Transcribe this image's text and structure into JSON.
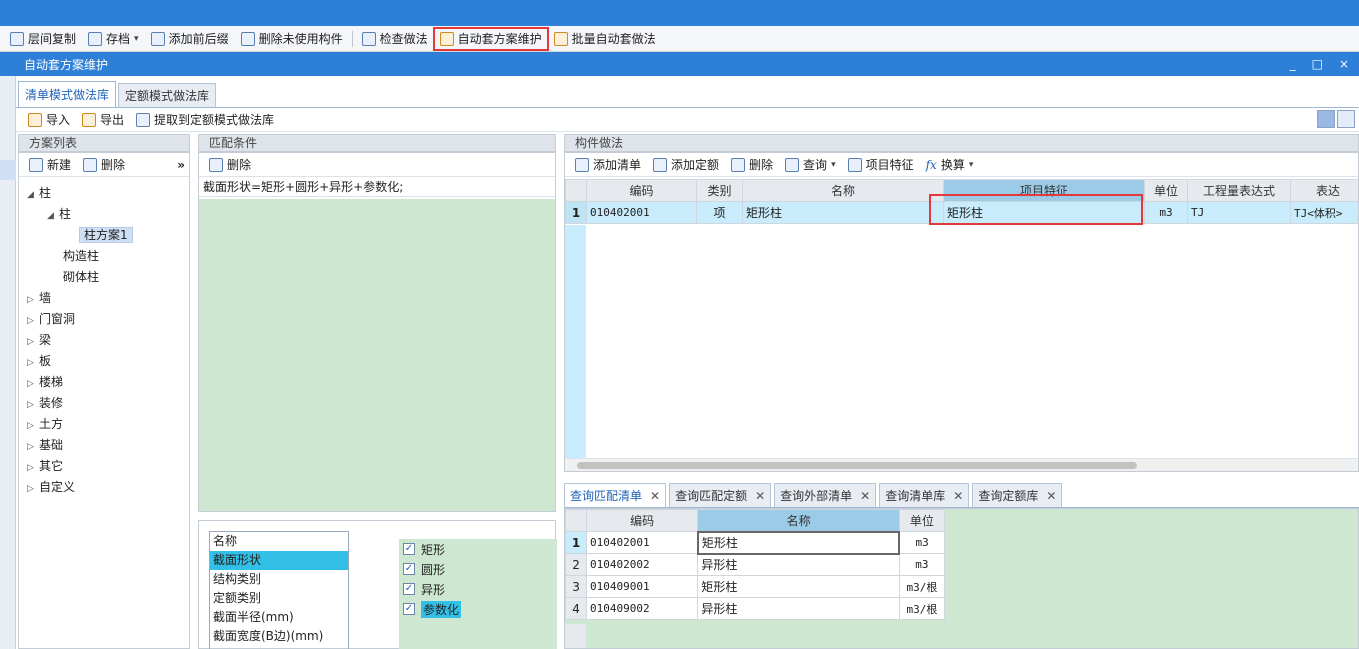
{
  "toolbar": {
    "items": [
      {
        "label": "层间复制",
        "icon": "layer-copy-icon"
      },
      {
        "label": "存档",
        "icon": "archive-icon"
      },
      {
        "label": "添加前后缀",
        "icon": "add-prefix-icon"
      },
      {
        "label": "删除未使用构件",
        "icon": "delete-unused-icon"
      },
      {
        "label": "检查做法",
        "icon": "check-method-icon"
      },
      {
        "label": "自动套方案维护",
        "icon": "auto-scheme-icon"
      },
      {
        "label": "批量自动套做法",
        "icon": "batch-auto-icon"
      }
    ],
    "caret": "▾"
  },
  "window": {
    "title": "自动套方案维护",
    "minimize": "_",
    "maximize": "□",
    "close": "×"
  },
  "tabs": [
    {
      "label": "清单模式做法库"
    },
    {
      "label": "定额模式做法库"
    }
  ],
  "subtool": {
    "import": "导入",
    "export": "导出",
    "extract": "提取到定额模式做法库"
  },
  "scheme_list": {
    "title": "方案列表",
    "new": "新建",
    "delete": "删除",
    "more": "»",
    "tree": [
      {
        "label": "柱",
        "arrow": "◢"
      },
      {
        "label": "柱",
        "arrow": "◢"
      },
      {
        "label": "柱方案1",
        "arrow": ""
      },
      {
        "label": "构造柱",
        "arrow": ""
      },
      {
        "label": "砌体柱",
        "arrow": ""
      },
      {
        "label": "墙",
        "arrow": "▷"
      },
      {
        "label": "门窗洞",
        "arrow": "▷"
      },
      {
        "label": "梁",
        "arrow": "▷"
      },
      {
        "label": "板",
        "arrow": "▷"
      },
      {
        "label": "楼梯",
        "arrow": "▷"
      },
      {
        "label": "装修",
        "arrow": "▷"
      },
      {
        "label": "土方",
        "arrow": "▷"
      },
      {
        "label": "基础",
        "arrow": "▷"
      },
      {
        "label": "其它",
        "arrow": "▷"
      },
      {
        "label": "自定义",
        "arrow": "▷"
      }
    ]
  },
  "match": {
    "title": "匹配条件",
    "delete": "删除",
    "condition": "截面形状=矩形+圆形+异形+参数化;",
    "attributes": [
      "名称",
      "截面形状",
      "结构类别",
      "定额类别",
      "截面半径(mm)",
      "截面宽度(B边)(mm)"
    ],
    "options": [
      {
        "label": "矩形",
        "checked": "✓"
      },
      {
        "label": "圆形",
        "checked": "✓"
      },
      {
        "label": "异形",
        "checked": "✓"
      },
      {
        "label": "参数化",
        "checked": "✓"
      }
    ]
  },
  "method": {
    "title": "构件做法",
    "toolbar": {
      "add_list": "添加清单",
      "add_quota": "添加定额",
      "delete": "删除",
      "query": "查询",
      "feature": "项目特征",
      "fx": "fx",
      "convert": "换算"
    },
    "headers": [
      "编码",
      "类别",
      "名称",
      "项目特征",
      "单位",
      "工程量表达式",
      "表达"
    ],
    "rows": [
      {
        "no": "1",
        "code": "010402001",
        "type": "项",
        "name": "矩形柱",
        "feature": "矩形柱",
        "unit": "m3",
        "expr": "TJ",
        "desc": "TJ<体积>"
      }
    ]
  },
  "bottom": {
    "tabs": [
      {
        "label": "查询匹配清单"
      },
      {
        "label": "查询匹配定额"
      },
      {
        "label": "查询外部清单"
      },
      {
        "label": "查询清单库"
      },
      {
        "label": "查询定额库"
      }
    ],
    "close": "✕",
    "headers": [
      "编码",
      "名称",
      "单位"
    ],
    "rows": [
      {
        "no": "1",
        "code": "010402001",
        "name": "矩形柱",
        "unit": "m3"
      },
      {
        "no": "2",
        "code": "010402002",
        "name": "异形柱",
        "unit": "m3"
      },
      {
        "no": "3",
        "code": "010409001",
        "name": "矩形柱",
        "unit": "m3/根"
      },
      {
        "no": "4",
        "code": "010409002",
        "name": "异形柱",
        "unit": "m3/根"
      }
    ]
  }
}
